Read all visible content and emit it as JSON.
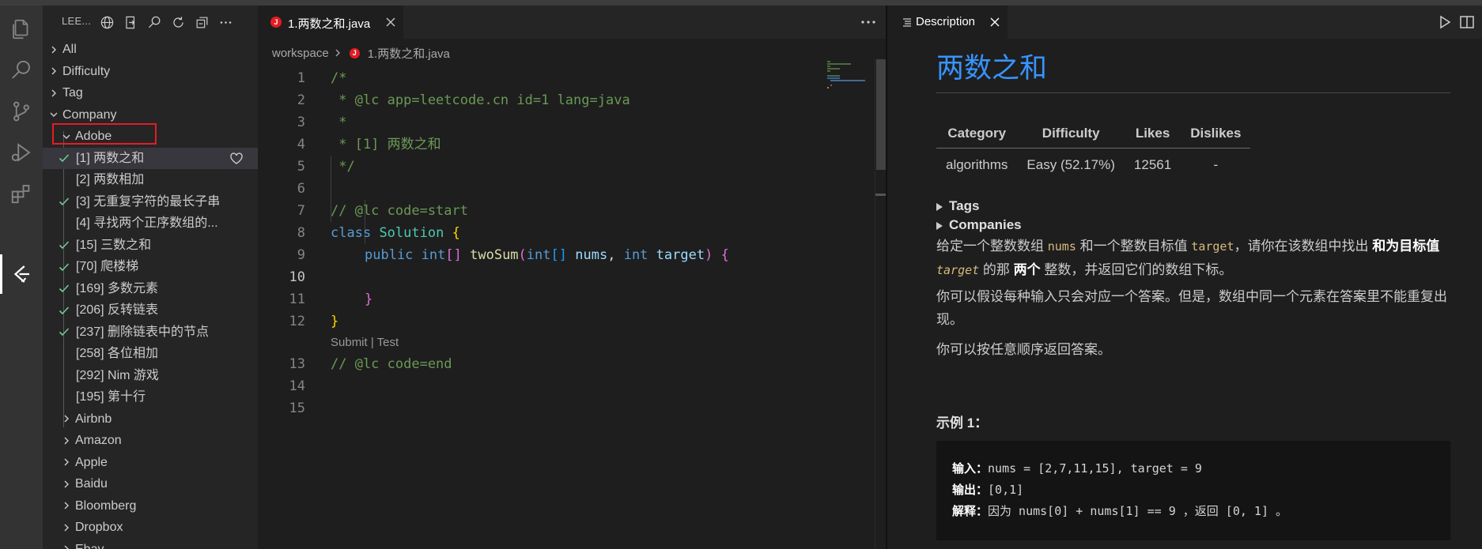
{
  "sidebar": {
    "title": "LEE...",
    "tree": [
      {
        "label": "All",
        "level": 0,
        "chevron": "right"
      },
      {
        "label": "Difficulty",
        "level": 0,
        "chevron": "right"
      },
      {
        "label": "Tag",
        "level": 0,
        "chevron": "right"
      },
      {
        "label": "Company",
        "level": 0,
        "chevron": "down"
      },
      {
        "label": "Adobe",
        "level": 1,
        "chevron": "down"
      },
      {
        "label": "[1] 两数之和",
        "level": 2,
        "solved": true,
        "selected": true
      },
      {
        "label": "[2] 两数相加",
        "level": 2,
        "solved": false
      },
      {
        "label": "[3] 无重复字符的最长子串",
        "level": 2,
        "solved": true
      },
      {
        "label": "[4] 寻找两个正序数组的...",
        "level": 2,
        "solved": false
      },
      {
        "label": "[15] 三数之和",
        "level": 2,
        "solved": true
      },
      {
        "label": "[70] 爬楼梯",
        "level": 2,
        "solved": true
      },
      {
        "label": "[169] 多数元素",
        "level": 2,
        "solved": true
      },
      {
        "label": "[206] 反转链表",
        "level": 2,
        "solved": true
      },
      {
        "label": "[237] 删除链表中的节点",
        "level": 2,
        "solved": true
      },
      {
        "label": "[258] 各位相加",
        "level": 2,
        "solved": false
      },
      {
        "label": "[292] Nim 游戏",
        "level": 2,
        "solved": false
      },
      {
        "label": "[195] 第十行",
        "level": 2,
        "solved": false
      },
      {
        "label": "Airbnb",
        "level": 1,
        "chevron": "right"
      },
      {
        "label": "Amazon",
        "level": 1,
        "chevron": "right"
      },
      {
        "label": "Apple",
        "level": 1,
        "chevron": "right"
      },
      {
        "label": "Baidu",
        "level": 1,
        "chevron": "right"
      },
      {
        "label": "Bloomberg",
        "level": 1,
        "chevron": "right"
      },
      {
        "label": "Dropbox",
        "level": 1,
        "chevron": "right"
      },
      {
        "label": "Ebay",
        "level": 1,
        "chevron": "right"
      }
    ]
  },
  "editor": {
    "tab_label": "1.两数之和.java",
    "tab_badge": "J",
    "breadcrumb_folder": "workspace",
    "breadcrumb_file": "1.两数之和.java",
    "line_numbers": [
      "1",
      "2",
      "3",
      "4",
      "5",
      "6",
      "7",
      "8",
      "9",
      "10",
      "11",
      "12",
      "13",
      "14",
      "15"
    ],
    "current_line": "10",
    "code": {
      "l1": "/*",
      "l2": " * @lc app=leetcode.cn id=1 lang=java",
      "l3": " *",
      "l4": " * [1] 两数之和",
      "l5": " */",
      "l7": "// @lc code=start",
      "l8_kw": "class",
      "l8_type": "Solution",
      "l8_brace": "{",
      "l9_public": "public",
      "l9_int": "int",
      "l9_brk": "[]",
      "l9_fn": "twoSum",
      "l9_paren_open": "(",
      "l9_int2": "int",
      "l9_brk2": "[]",
      "l9_nums": "nums",
      "l9_comma": ",",
      "l9_int3": "int",
      "l9_target": "target",
      "l9_paren_close": ")",
      "l9_brace": "{",
      "l11": "}",
      "l12": "}",
      "l13": "// @lc code=end"
    },
    "codelens": "Submit | Test"
  },
  "panel": {
    "tab_label": "Description",
    "title": "两数之和",
    "table_headers": [
      "Category",
      "Difficulty",
      "Likes",
      "Dislikes"
    ],
    "table_values": [
      "algorithms",
      "Easy (52.17%)",
      "12561",
      "-"
    ],
    "tags_label": "Tags",
    "companies_label": "Companies",
    "p1_a": "给定一个整数数组 ",
    "p1_nums": "nums",
    "p1_b": " 和一个整数目标值 ",
    "p1_target": "target",
    "p1_c": "，请你在该数组中找出 ",
    "p1_bold1": "和为目标值",
    "p1_d": " ",
    "p1_target2": "target",
    "p1_e": " 的那 ",
    "p1_bold2": "两个",
    "p1_f": " 整数，并返回它们的数组下标。",
    "p2": "你可以假设每种输入只会对应一个答案。但是，数组中同一个元素在答案里不能重复出现。",
    "p3": "你可以按任意顺序返回答案。",
    "example_title": "示例 1：",
    "ex_in_label": "输入：",
    "ex_in": "nums = [2,7,11,15], target = 9",
    "ex_out_label": "输出：",
    "ex_out": "[0,1]",
    "ex_exp_label": "解释：",
    "ex_exp": "因为 nums[0] + nums[1] == 9 ，返回 [0, 1] 。"
  },
  "colors": {
    "accent_red": "#e51c23",
    "check_green": "#73c991",
    "title_blue": "#3794ff"
  }
}
